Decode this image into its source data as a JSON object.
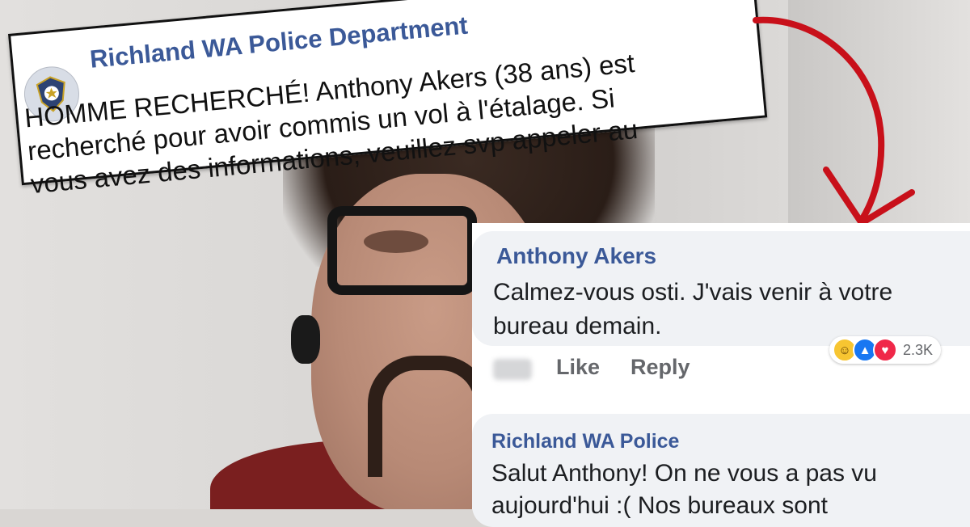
{
  "post": {
    "page_name": "Richland WA Police Department",
    "lines": [
      "HOMME RECHERCHÉ! Anthony Akers (38 ans) est",
      "recherché pour avoir commis un vol à l'étalage. Si",
      "vous avez des informations, veuillez svp appeler au"
    ]
  },
  "comments": [
    {
      "author": "Anthony Akers",
      "lines": [
        "Calmez-vous osti. J'vais venir à votre",
        "bureau demain."
      ],
      "reaction_count": "2.3K",
      "like_label": "Like",
      "reply_label": "Reply"
    },
    {
      "author": "Richland WA Police",
      "lines": [
        "Salut Anthony! On ne vous a pas vu",
        "aujourd'hui :( Nos bureaux sont"
      ]
    }
  ],
  "colors": {
    "link_blue": "#3b5998",
    "arrow_red": "#c8101a",
    "bubble_gray": "#f0f2f5"
  },
  "icons": {
    "avatar": "police-badge-icon",
    "arrow": "curved-arrow-icon",
    "reactions": [
      "haha-reaction-icon",
      "like-reaction-icon",
      "love-reaction-icon"
    ]
  }
}
